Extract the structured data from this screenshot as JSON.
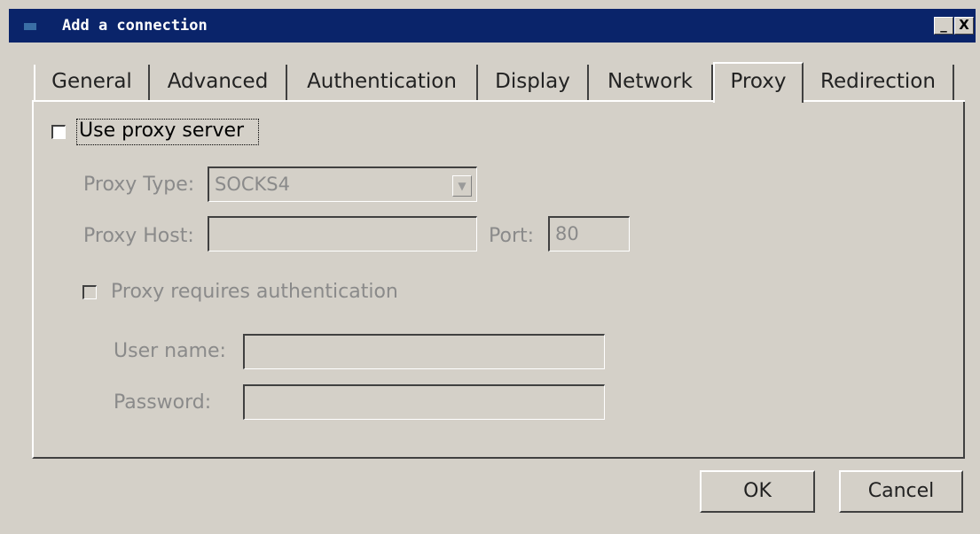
{
  "window": {
    "title": "Add a connection",
    "minimize_glyph": "_",
    "close_glyph": "X"
  },
  "tabs": [
    {
      "label": "General"
    },
    {
      "label": "Advanced"
    },
    {
      "label": "Authentication"
    },
    {
      "label": "Display"
    },
    {
      "label": "Network"
    },
    {
      "label": "Proxy",
      "active": true
    },
    {
      "label": "Redirection"
    }
  ],
  "proxy": {
    "use_proxy_label": "Use proxy server",
    "use_proxy_checked": false,
    "type_label": "Proxy Type:",
    "type_value": "SOCKS4",
    "host_label": "Proxy Host:",
    "host_value": "",
    "port_label": "Port:",
    "port_value": "80",
    "auth_label": "Proxy requires authentication",
    "auth_checked": false,
    "username_label": "User name:",
    "username_value": "",
    "password_label": "Password:",
    "password_value": ""
  },
  "buttons": {
    "ok": "OK",
    "cancel": "Cancel"
  },
  "colors": {
    "titlebar": "#0a246a",
    "face": "#d4d0c8",
    "disabled_text": "#8a8a8a"
  }
}
